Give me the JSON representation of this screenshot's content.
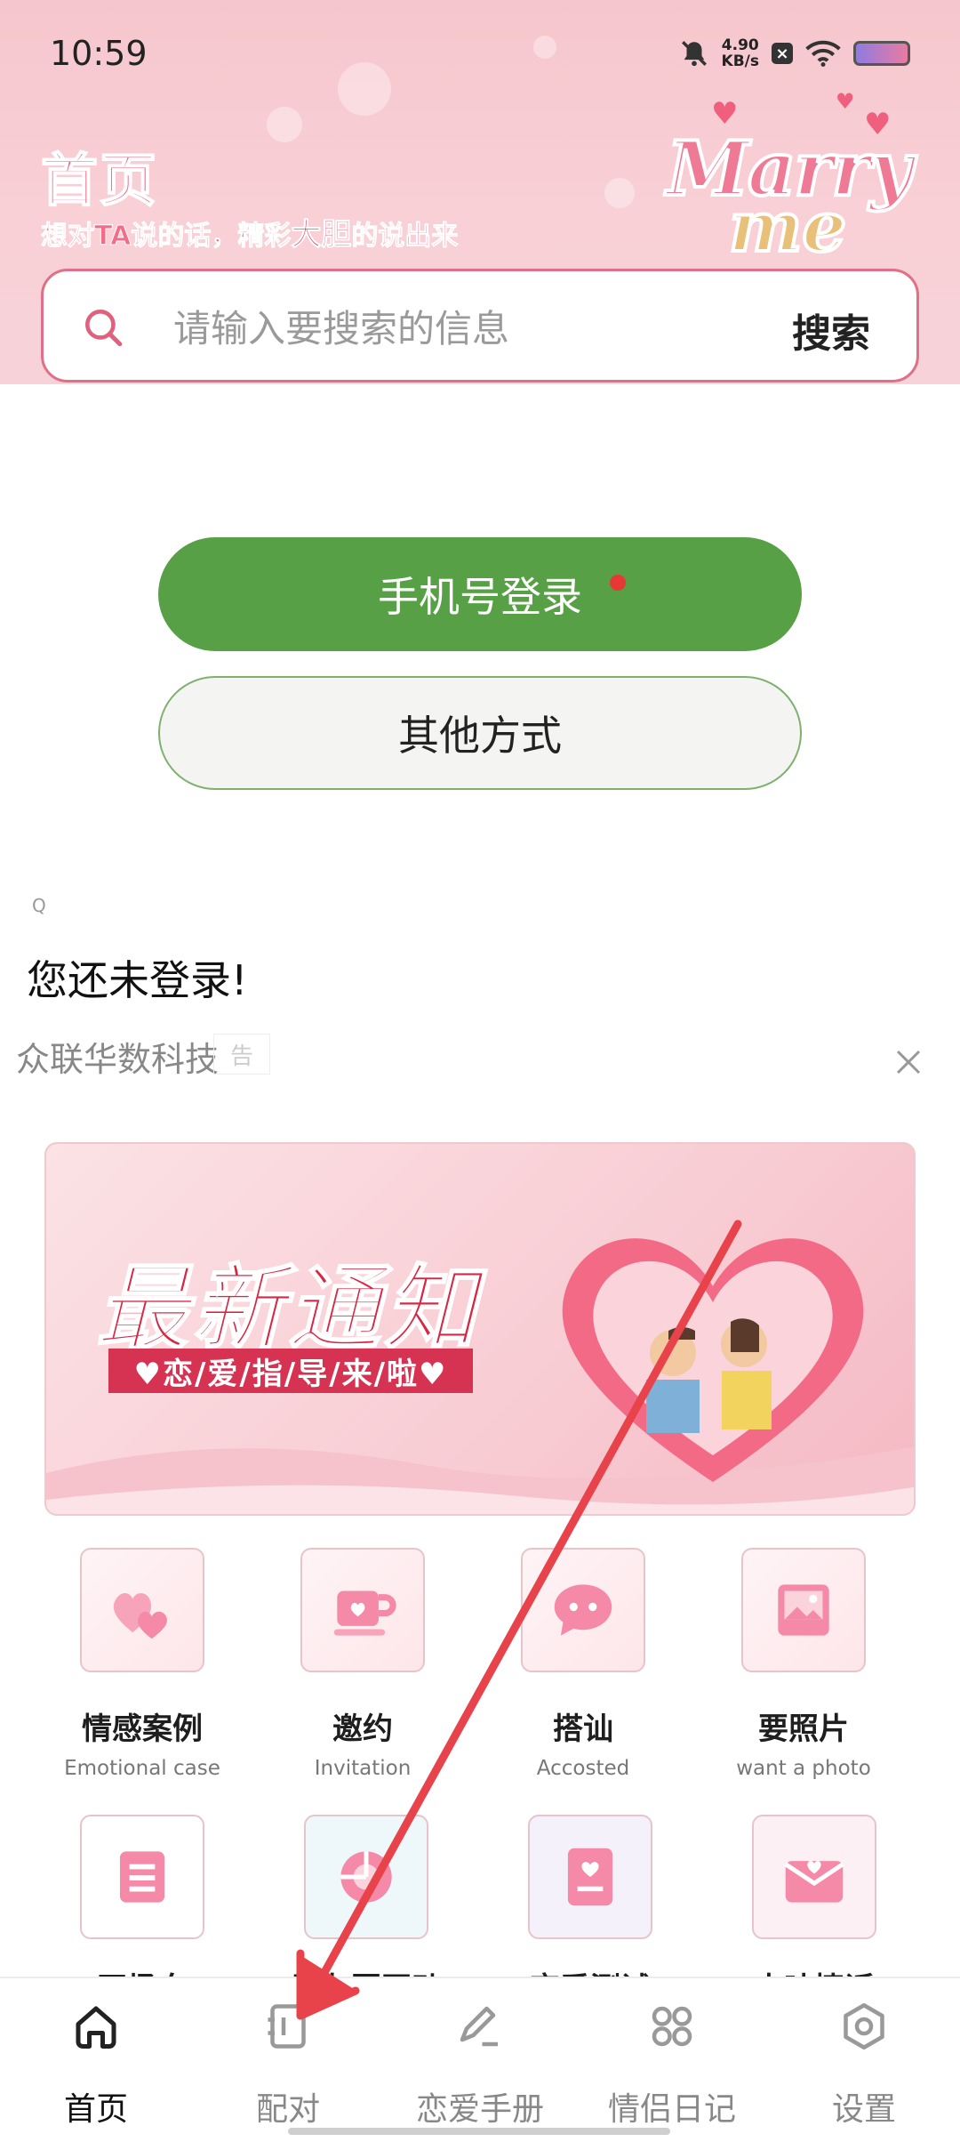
{
  "status_bar": {
    "time": "10:59",
    "speed_value": "4.90",
    "speed_unit": "KB/s",
    "icons": [
      "mute-bell-icon",
      "close-app-icon",
      "wifi-icon",
      "battery-icon"
    ]
  },
  "header": {
    "title": "首页",
    "tagline_before": "想对TA说的话，精彩",
    "tagline_emphasis": "大胆",
    "tagline_after": "的说出来",
    "logo_line1": "Marry",
    "logo_line2": "me"
  },
  "search": {
    "placeholder": "请输入要搜索的信息",
    "button_label": "搜索"
  },
  "login": {
    "phone_button": "手机号登录",
    "other_button": "其他方式",
    "tiny_mark": "Q",
    "status_text": "您还未登录!"
  },
  "ad": {
    "label": "众联华数科技",
    "tag": "告"
  },
  "banner": {
    "title": "最新通知",
    "subtitle": "♥恋/爱/指/导/来/啦♥"
  },
  "features": [
    {
      "title": "情感案例",
      "subtitle": "Emotional case",
      "icon": "hearts-icon"
    },
    {
      "title": "邀约",
      "subtitle": "Invitation",
      "icon": "cup-icon"
    },
    {
      "title": "搭讪",
      "subtitle": "Accosted",
      "icon": "chat-bubble-icon"
    },
    {
      "title": "要照片",
      "subtitle": "want a photo",
      "icon": "photo-icon"
    }
  ],
  "features_row2": [
    {
      "label": "开场白",
      "icon": "list-icon"
    },
    {
      "label": "朋友圈互动",
      "icon": "camera-lens-icon"
    },
    {
      "label": "恋爱测试",
      "icon": "book-heart-icon"
    },
    {
      "label": "土味情话",
      "icon": "envelope-heart-icon"
    }
  ],
  "bottom_nav": [
    {
      "label": "首页",
      "icon": "home-icon",
      "active": true
    },
    {
      "label": "配对",
      "icon": "pair-icon",
      "active": false
    },
    {
      "label": "恋爱手册",
      "icon": "pen-icon",
      "active": false
    },
    {
      "label": "情侣日记",
      "icon": "grid-flower-icon",
      "active": false
    },
    {
      "label": "设置",
      "icon": "settings-hexagon-icon",
      "active": false
    }
  ],
  "colors": {
    "primary_pink": "#f05b7a",
    "login_green": "#57a045",
    "annotation_red": "#e8424a"
  }
}
